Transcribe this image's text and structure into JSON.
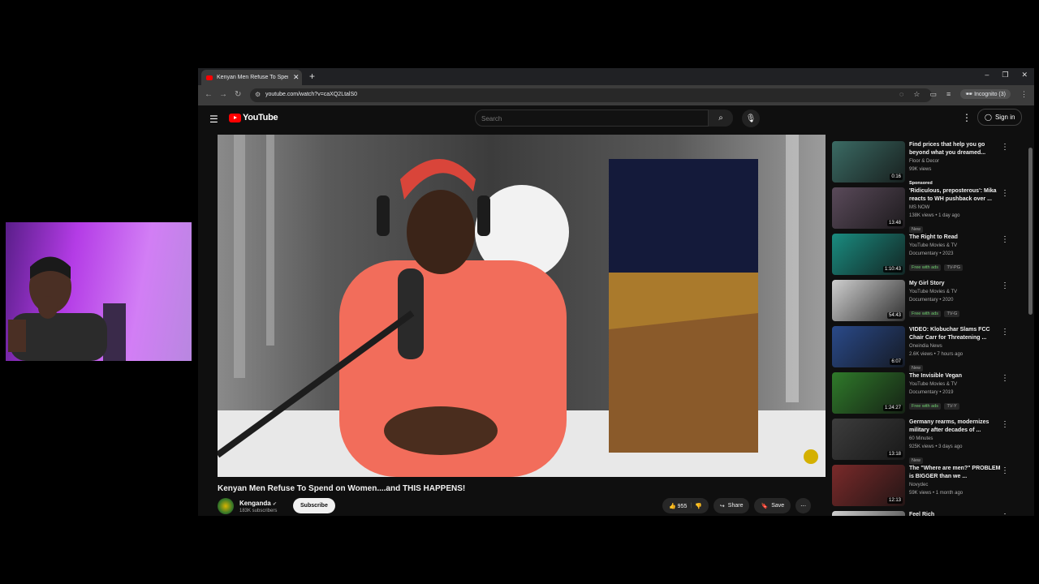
{
  "browser": {
    "tab_title": "Kenyan Men Refuse To Spend o",
    "new_tab": "+",
    "url": "youtube.com/watch?v=caXQ2LtalS0",
    "incognito_label": "Incognito (3)"
  },
  "youtube": {
    "logo_text": "YouTube",
    "search_placeholder": "Search",
    "sign_in": "Sign in"
  },
  "video": {
    "title": "Kenyan Men Refuse To Spend on Women....and THIS HAPPENS!",
    "channel": "Kenganda",
    "subscribers": "183K subscribers",
    "subscribe_label": "Subscribe",
    "likes": "955",
    "share_label": "Share",
    "save_label": "Save"
  },
  "related": [
    {
      "title": "Find prices that help you go beyond what you dreamed...",
      "channel": "Floor & Decor",
      "meta": "99K views",
      "badge": "Sponsored",
      "badge_type": "spons",
      "duration": "0:16",
      "thumb": "#3b6b64"
    },
    {
      "title": "'Ridiculous, preposterous': Mika reacts to WH pushback over ...",
      "channel": "MS NOW",
      "meta": "138K views • 1 day ago",
      "badge": "New",
      "badge_type": "new",
      "duration": "13:48",
      "thumb": "#5a4a5a"
    },
    {
      "title": "The Right to Read",
      "channel": "YouTube Movies & TV",
      "meta": "Documentary • 2023",
      "badge": "Free with ads",
      "badge_type": "green",
      "badge2": "TV-PG",
      "duration": "1:10:43",
      "thumb": "#1a8c80"
    },
    {
      "title": "My Girl Story",
      "channel": "YouTube Movies & TV",
      "meta": "Documentary • 2020",
      "badge": "Free with ads",
      "badge_type": "green",
      "badge2": "TV-G",
      "duration": "54:43",
      "thumb": "#cfcfcf"
    },
    {
      "title": "VIDEO: Klobuchar Slams FCC Chair Carr for Threatening ...",
      "channel": "Oneindia News",
      "meta": "2.6K views • 7 hours ago",
      "badge": "New",
      "badge_type": "new",
      "duration": "6:07",
      "thumb": "#2a4a8a"
    },
    {
      "title": "The Invisible Vegan",
      "channel": "YouTube Movies & TV",
      "meta": "Documentary • 2019",
      "badge": "Free with ads",
      "badge_type": "green",
      "badge2": "TV-Y",
      "duration": "1:24:27",
      "thumb": "#2f7a2a"
    },
    {
      "title": "Germany rearms, modernizes military after decades of ...",
      "channel": "60 Minutes",
      "meta": "925K views • 3 days ago",
      "badge": "New",
      "badge_type": "new",
      "duration": "13:18",
      "thumb": "#3d3d3d"
    },
    {
      "title": "The \"Where are men?\" PROBLEM is BIGGER than we ...",
      "channel": "Novydec",
      "meta": "59K views • 1 month ago",
      "badge": "",
      "badge_type": "",
      "duration": "12:13",
      "thumb": "#7a2a2a"
    },
    {
      "title": "Feel Rich",
      "channel": "",
      "meta": "",
      "badge": "",
      "badge_type": "",
      "duration": "",
      "thumb": "#d0d0d0"
    }
  ]
}
